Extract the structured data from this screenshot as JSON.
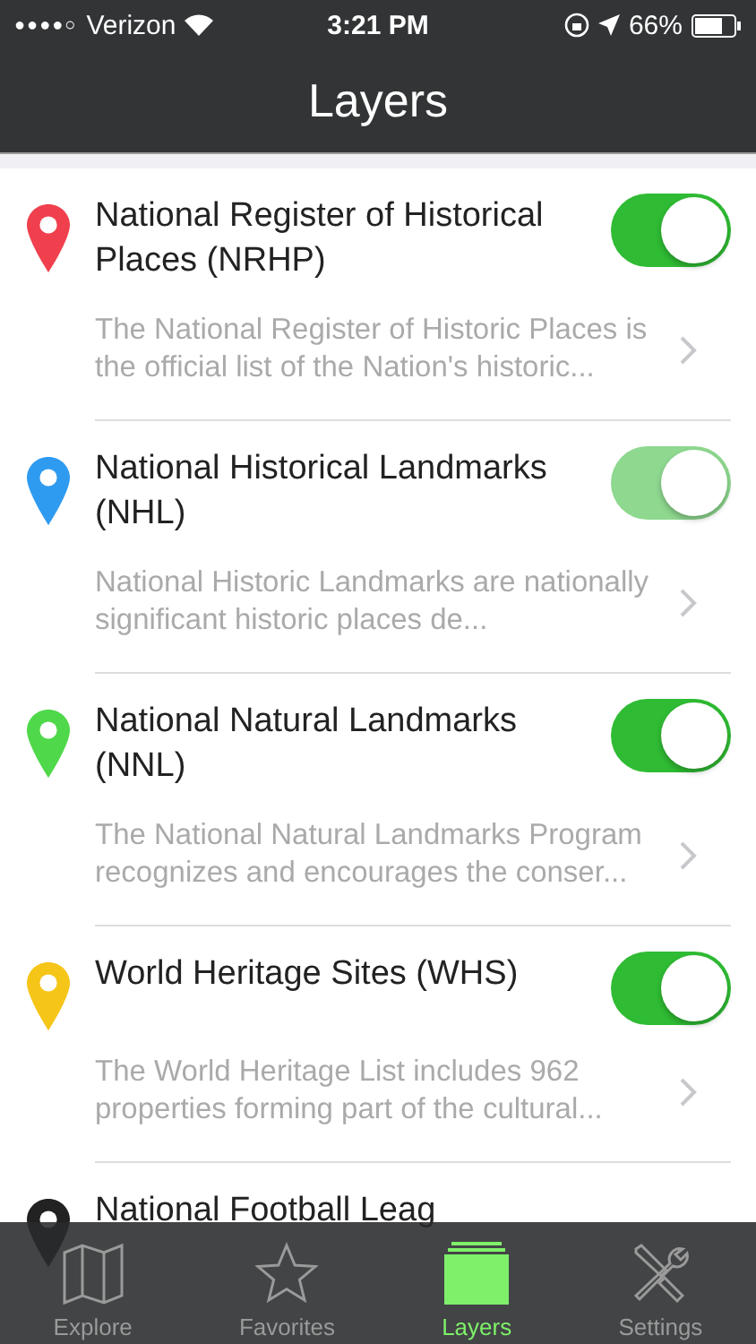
{
  "status_bar": {
    "signal": "●●●●○",
    "carrier": "Verizon",
    "time": "3:21 PM",
    "battery": "66%"
  },
  "nav": {
    "title": "Layers"
  },
  "layers": [
    {
      "title": "National Register of Historical Places (NRHP)",
      "description": "The National Register of Historic Places is the official list of the Nation's historic...",
      "color": "#f0404e",
      "on": true,
      "disabled": false
    },
    {
      "title": "National Historical Landmarks (NHL)",
      "description": "National Historic Landmarks are nationally significant historic places de...",
      "color": "#2f9bf0",
      "on": true,
      "disabled": true
    },
    {
      "title": "National Natural Landmarks (NNL)",
      "description": "The National Natural Landmarks Program recognizes and encourages the conser...",
      "color": "#4fd84a",
      "on": true,
      "disabled": false
    },
    {
      "title": "World Heritage Sites (WHS)",
      "description": "The World Heritage List includes 962 properties forming part of the cultural...",
      "color": "#f5c518",
      "on": true,
      "disabled": false
    }
  ],
  "hidden_row": {
    "title": "National Football Leag",
    "color": "#222222"
  },
  "tabs": [
    {
      "label": "Explore",
      "kind": "map",
      "selected": false
    },
    {
      "label": "Favorites",
      "kind": "star",
      "selected": false
    },
    {
      "label": "Layers",
      "kind": "layers",
      "selected": true
    },
    {
      "label": "Settings",
      "kind": "tools",
      "selected": false
    }
  ]
}
